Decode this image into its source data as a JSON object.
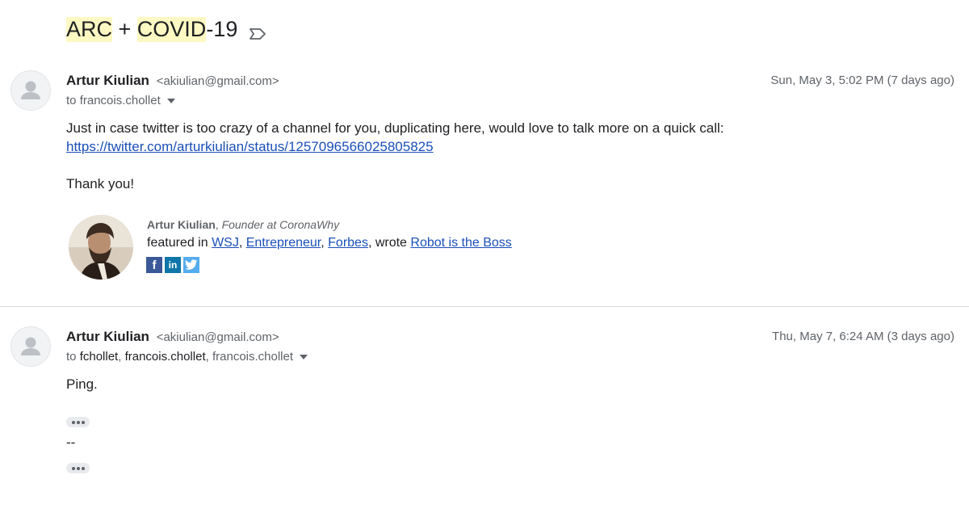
{
  "thread": {
    "subject_parts": [
      {
        "text": "ARC",
        "highlight": true
      },
      {
        "text": " + ",
        "highlight": false
      },
      {
        "text": "COVID",
        "highlight": true
      },
      {
        "text": "-19",
        "highlight": false
      }
    ],
    "label_icon": "label-outline-icon",
    "highlight_color": "#fef9c3"
  },
  "messages": [
    {
      "sender_name": "Artur Kiulian",
      "sender_email": "<akiulian@gmail.com>",
      "to_prefix": "to ",
      "recipients": [
        "francois.chollet"
      ],
      "date": "Sun, May 3, 5:02 PM (7 days ago)",
      "body_line1": "Just in case twitter is too crazy of a channel for you, duplicating here, would love to talk more on a quick call:",
      "link": "https://twitter.com/arturkiulian/status/1257096566025805825",
      "thanks": "Thank you!",
      "signature": {
        "name": "Artur Kiulian",
        "sep": ", ",
        "title": "Founder at CoronaWhy",
        "featured_prefix": "featured in ",
        "links": [
          "WSJ",
          "Entrepreneur",
          "Forbes"
        ],
        "wrote_text": ", wrote ",
        "book_link": "Robot is the Boss",
        "social_icons": [
          "facebook-icon",
          "linkedin-icon",
          "twitter-icon"
        ],
        "social_glyphs": {
          "facebook": "f",
          "linkedin": "in"
        }
      }
    },
    {
      "sender_name": "Artur Kiulian",
      "sender_email": "<akiulian@gmail.com>",
      "to_prefix": "to ",
      "recipients": [
        "fchollet",
        "francois.chollet",
        "francois.chollet"
      ],
      "date": "Thu, May 7, 6:24 AM (3 days ago)",
      "body": "Ping.",
      "sig_separator": "--"
    }
  ],
  "colors": {
    "link": "#1a4fb8",
    "divider": "#dadce0",
    "muted_text": "#5f6368"
  }
}
